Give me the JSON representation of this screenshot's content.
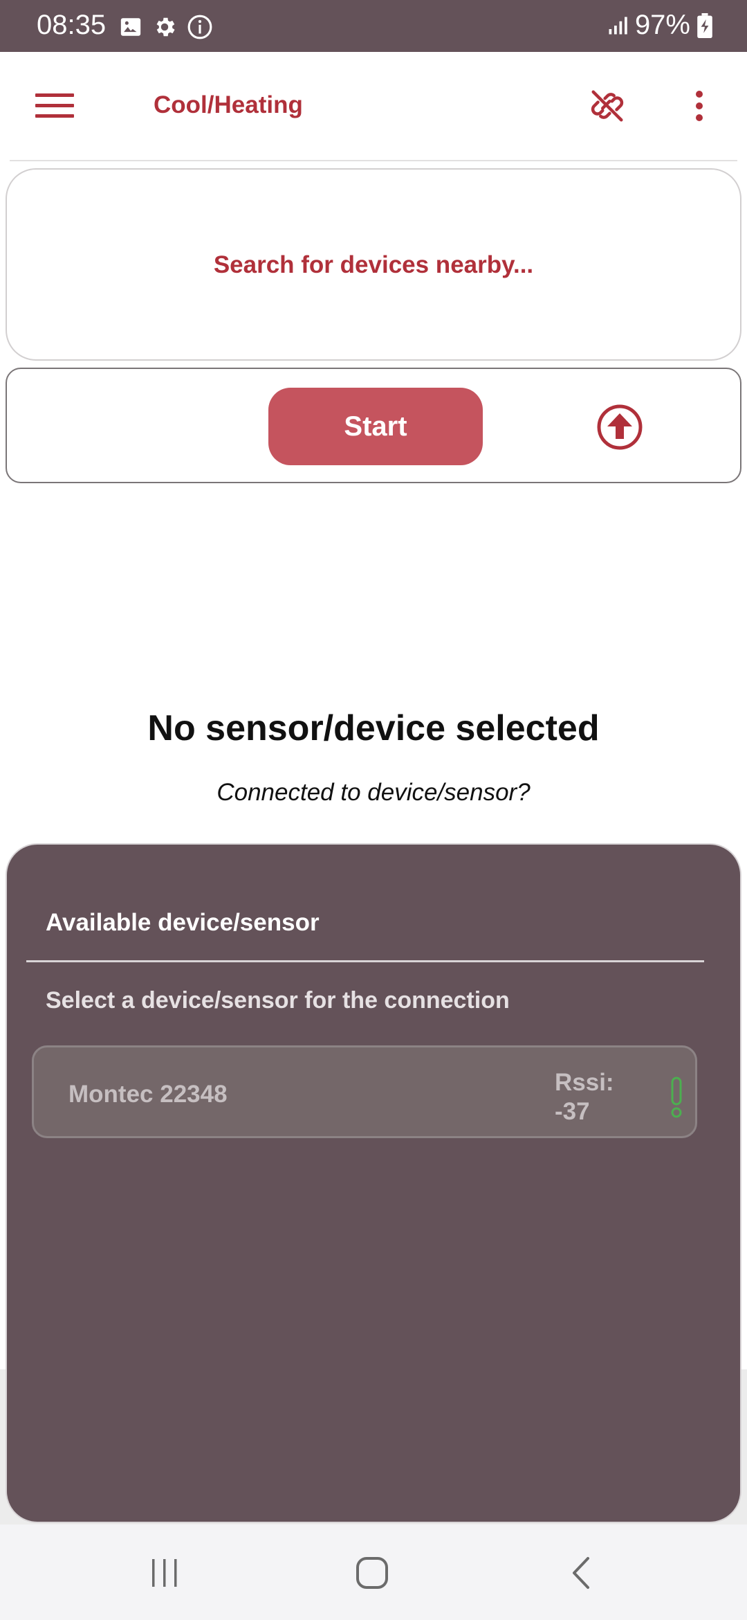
{
  "status_bar": {
    "time": "08:35",
    "battery": "97%",
    "icons_left": [
      "image-icon",
      "settings-gear-icon",
      "info-icon"
    ],
    "icons_right": [
      "signal-icon",
      "battery-charging-icon"
    ]
  },
  "app_bar": {
    "title": "Cool/Heating",
    "menu_icon": "hamburger-menu-icon",
    "unlink_icon": "link-off-icon",
    "more_icon": "more-vert-icon"
  },
  "search": {
    "status_text": "Search for devices nearby..."
  },
  "controls": {
    "start_label": "Start",
    "upload_icon": "arrow-up-circle-icon"
  },
  "empty_state": {
    "title": "No sensor/device selected",
    "question": "Connected to device/sensor?"
  },
  "device_sheet": {
    "title": "Available device/sensor",
    "subtitle": "Select a device/sensor for the connection",
    "devices": [
      {
        "name": "Montec 22348",
        "rssi_label": "Rssi:",
        "rssi_value": "-37"
      }
    ]
  },
  "colors": {
    "accent_red": "#b0303a",
    "button_red": "#c5545e",
    "sheet_bg": "#645259",
    "signal_green": "#4caf50"
  },
  "nav_bar": {
    "icons": [
      "recent-apps-icon",
      "home-icon",
      "back-icon"
    ]
  }
}
